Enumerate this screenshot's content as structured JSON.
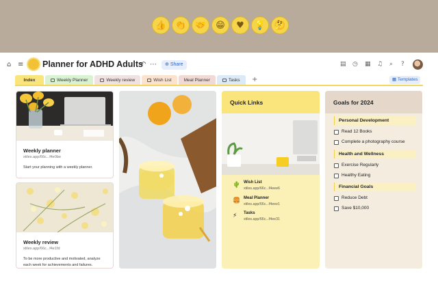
{
  "emojis": [
    {
      "icon": "thumbs-up-icon",
      "glyph": "👍"
    },
    {
      "icon": "clapping-hands-icon",
      "glyph": "👏"
    },
    {
      "icon": "handshake-icon",
      "glyph": "🤝"
    },
    {
      "icon": "grinning-face-icon",
      "glyph": "😁"
    },
    {
      "icon": "heart-icon",
      "glyph": "♥"
    },
    {
      "icon": "lightbulb-icon",
      "glyph": "💡"
    },
    {
      "icon": "thinking-face-icon",
      "glyph": "🤔"
    }
  ],
  "header": {
    "title": "Planner for ADHD Adults",
    "share_label": "Share"
  },
  "tabs": [
    {
      "label": "Index",
      "color": "#fae57c"
    },
    {
      "label": "Weekly Planner",
      "color": "#d9f2d2"
    },
    {
      "label": "Weekly review",
      "color": "#efe2e0"
    },
    {
      "label": "Wish List",
      "color": "#fbe3cf"
    },
    {
      "label": "Meal Planner",
      "color": "#f1dad6"
    },
    {
      "label": "Tasks",
      "color": "#dce9f7"
    }
  ],
  "templates_label": "Templates",
  "cards": {
    "weekly_planner": {
      "title": "Weekly planner",
      "link": "xtiles.app/66c...f4e0be",
      "description": "Start your planning with a weekly planner."
    },
    "weekly_review": {
      "title": "Weekly review",
      "link": "xtiles.app/66c...f4e1fd",
      "description": "To be more productive and motivated, analyze each week for achievements and failures."
    }
  },
  "quick_links": {
    "title": "Quick Links",
    "items": [
      {
        "name": "Wish List",
        "link": "xtiles.app/66c...f4eee6",
        "icon": "cactus-icon",
        "glyph": "🌵"
      },
      {
        "name": "Meal Planner",
        "link": "xtiles.app/66c...f4eee1",
        "icon": "burger-icon",
        "glyph": "🍔"
      },
      {
        "name": "Tasks",
        "link": "xtiles.app/66c...f4ee31",
        "icon": "lightning-icon",
        "glyph": "⚡"
      }
    ]
  },
  "goals": {
    "title": "Goals for 2024",
    "sections": [
      {
        "title": "Personal Development",
        "items": [
          "Read 12 Books",
          "Complete a photography course"
        ]
      },
      {
        "title": "Health and Wellness",
        "items": [
          "Exercise Regularly",
          "Healthy Eating"
        ]
      },
      {
        "title": "Financial Goals",
        "items": [
          "Reduce Debt",
          "Save $10,000"
        ]
      }
    ]
  }
}
